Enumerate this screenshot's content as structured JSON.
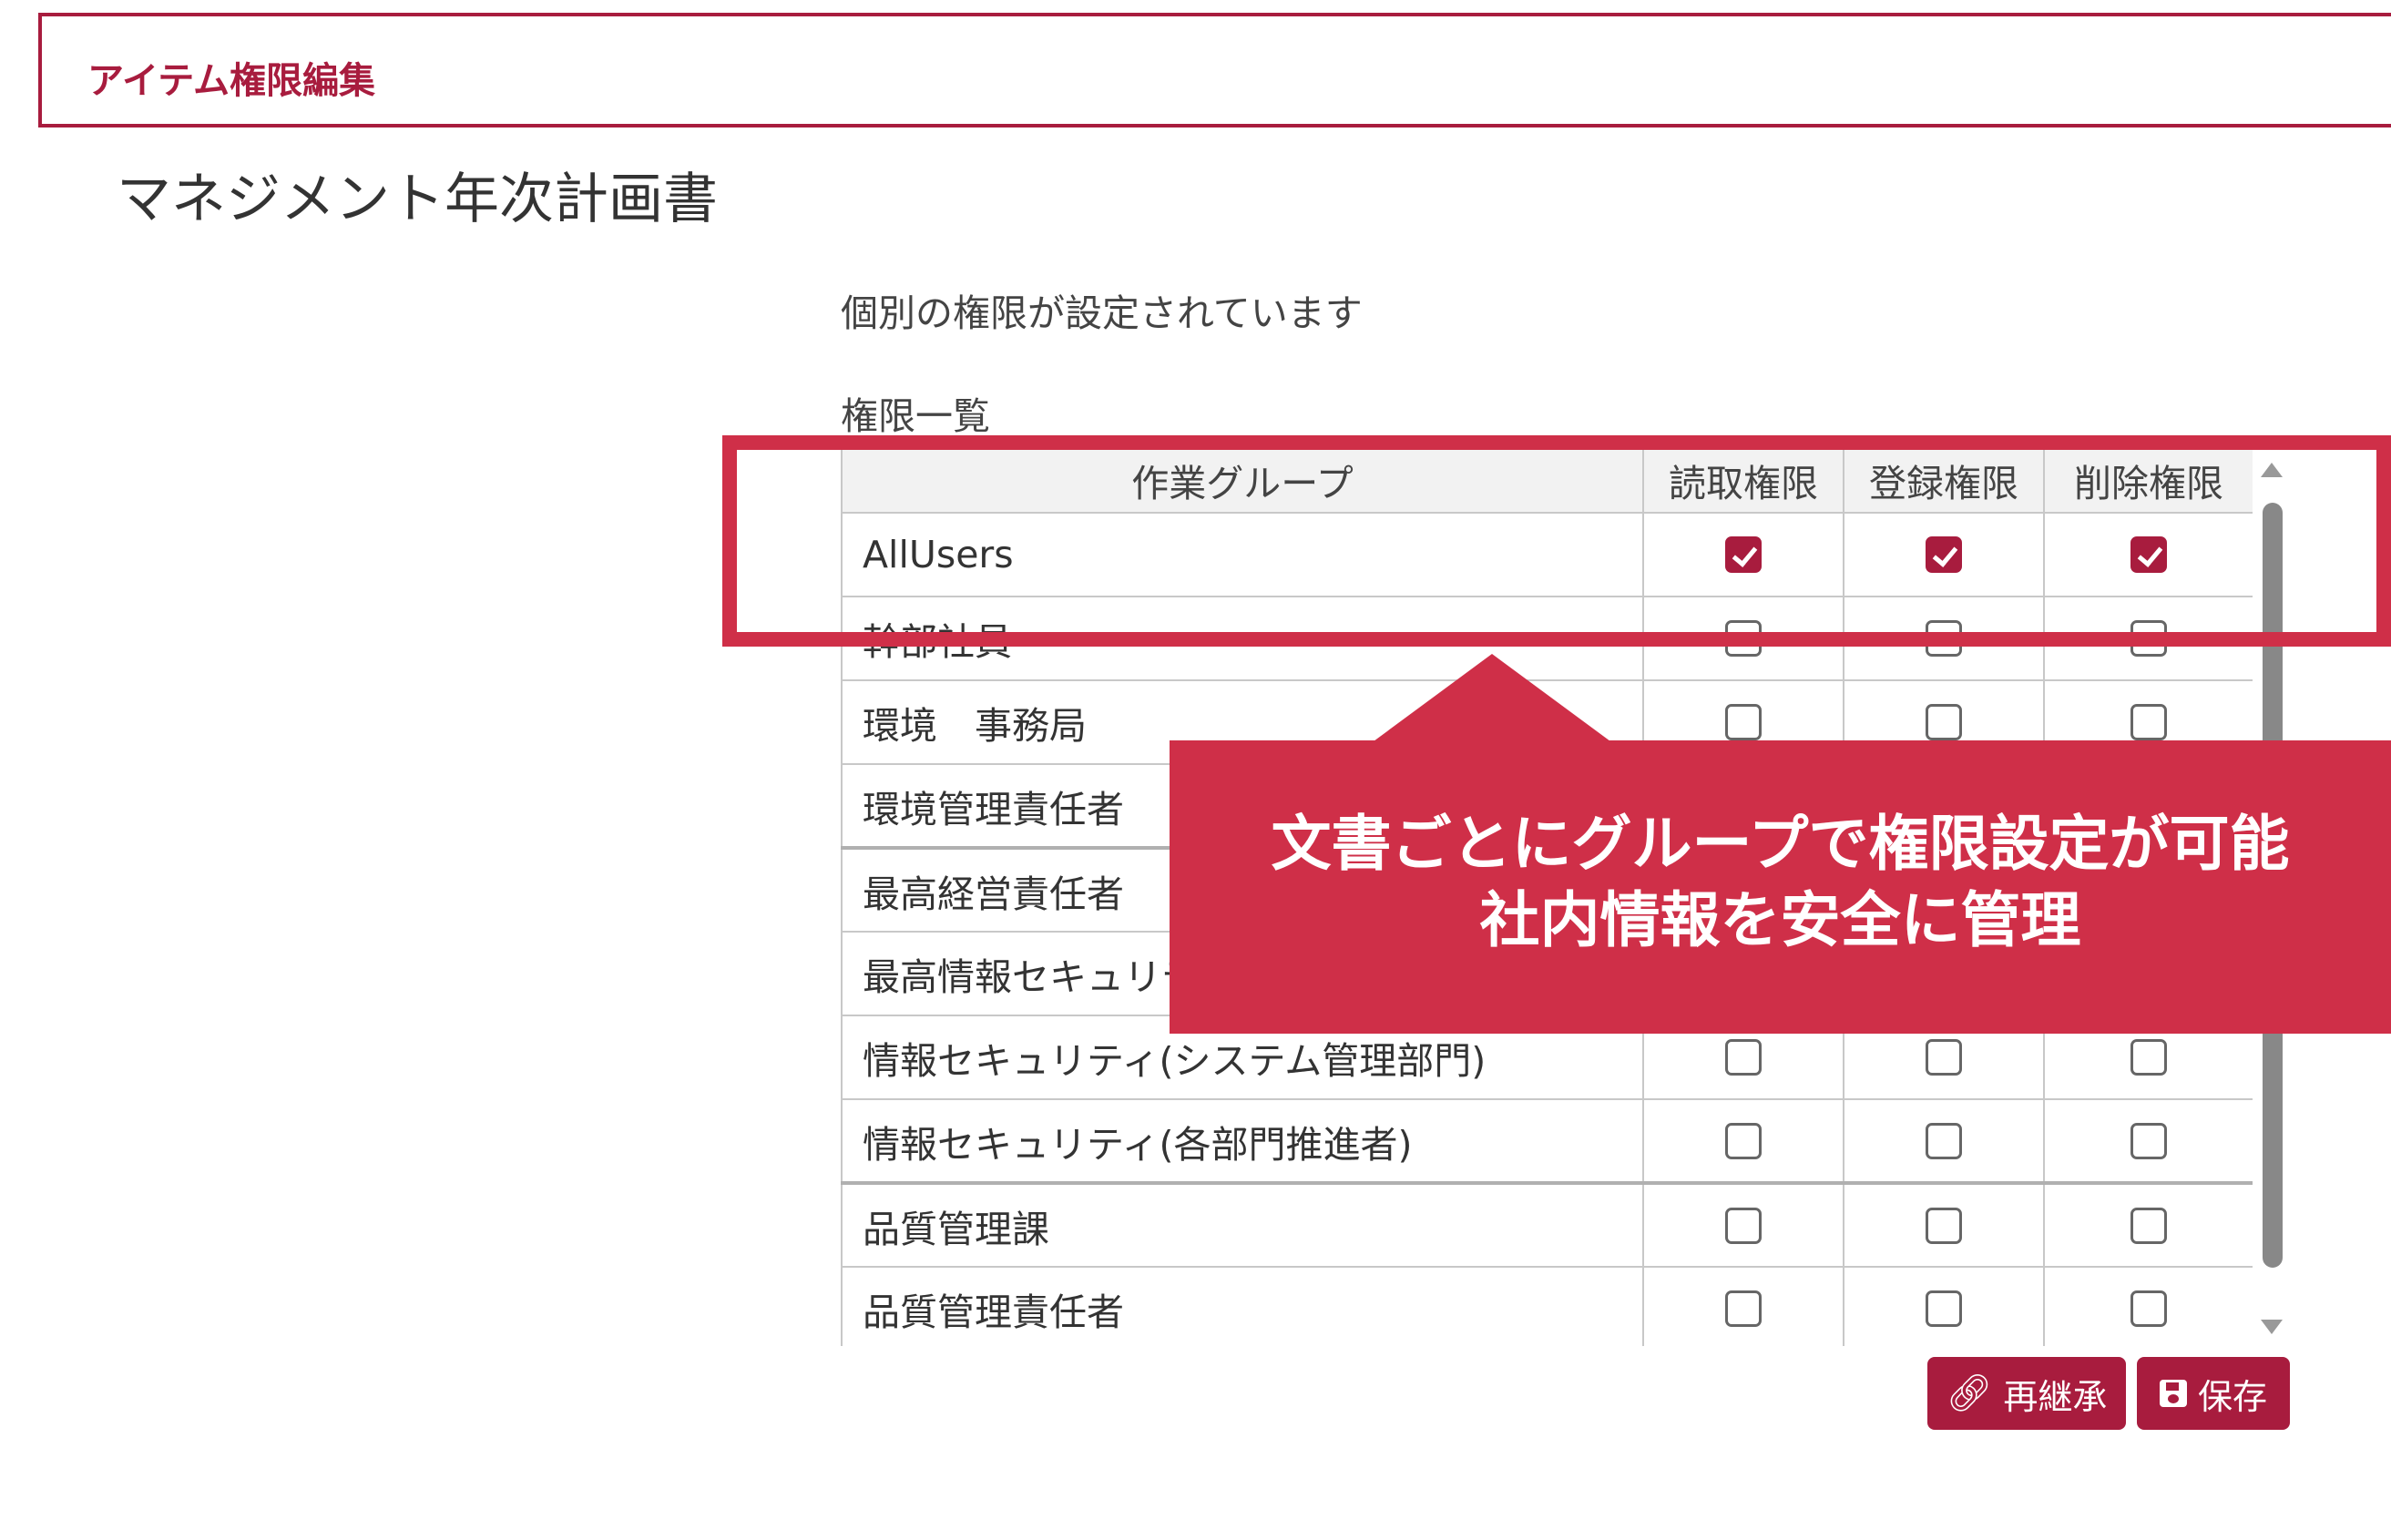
{
  "header": {
    "title": "アイテム権限編集"
  },
  "document": {
    "title": "マネジメント年次計画書"
  },
  "status_text": "個別の権限が設定されています",
  "permissions": {
    "list_label": "権限一覧",
    "columns": [
      "作業グループ",
      "読取権限",
      "登録権限",
      "削除権限"
    ],
    "rows": [
      {
        "name": "AllUsers",
        "read": true,
        "write": true,
        "delete": true
      },
      {
        "name": "幹部社員",
        "read": false,
        "write": false,
        "delete": false
      },
      {
        "name": "環境　事務局",
        "read": false,
        "write": false,
        "delete": false
      },
      {
        "name": "環境管理責任者",
        "read": false,
        "write": false,
        "delete": false
      },
      {
        "name": "最高経営責任者",
        "read": false,
        "write": false,
        "delete": false
      },
      {
        "name": "最高情報セキュリティ責任者",
        "read": false,
        "write": false,
        "delete": false
      },
      {
        "name": "情報セキュリティ(システム管理部門)",
        "read": false,
        "write": false,
        "delete": false
      },
      {
        "name": "情報セキュリティ(各部門推進者)",
        "read": false,
        "write": false,
        "delete": false
      },
      {
        "name": "品質管理課",
        "read": false,
        "write": false,
        "delete": false
      },
      {
        "name": "品質管理責任者",
        "read": false,
        "write": false,
        "delete": false
      }
    ]
  },
  "callout": {
    "line1": "文書ごとにグループで権限設定が可能",
    "line2": "社内情報を安全に管理"
  },
  "buttons": {
    "reinherit_label": "再継承",
    "reinherit_icon": "link-icon",
    "save_label": "保存",
    "save_icon": "save-icon"
  },
  "colors": {
    "accent": "#a81c3e",
    "callout": "#cf2f48"
  }
}
